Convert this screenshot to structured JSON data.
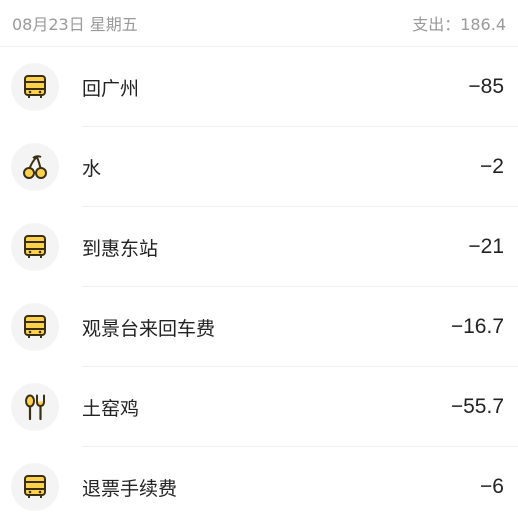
{
  "header": {
    "date": "08月23日 星期五",
    "summary": "支出：186.4"
  },
  "colors": {
    "icon_fill": "#FFD24D",
    "icon_stroke": "#3a2f12",
    "icon_bg": "#f4f4f4"
  },
  "items": [
    {
      "icon": "bus-icon",
      "label": "回广州",
      "amount": "−85"
    },
    {
      "icon": "cherry-icon",
      "label": "水",
      "amount": "−2"
    },
    {
      "icon": "bus-icon",
      "label": "到惠东站",
      "amount": "−21"
    },
    {
      "icon": "bus-icon",
      "label": "观景台来回车费",
      "amount": "−16.7"
    },
    {
      "icon": "spoon-fork-icon",
      "label": "土窑鸡",
      "amount": "−55.7"
    },
    {
      "icon": "bus-icon",
      "label": "退票手续费",
      "amount": "−6"
    }
  ]
}
